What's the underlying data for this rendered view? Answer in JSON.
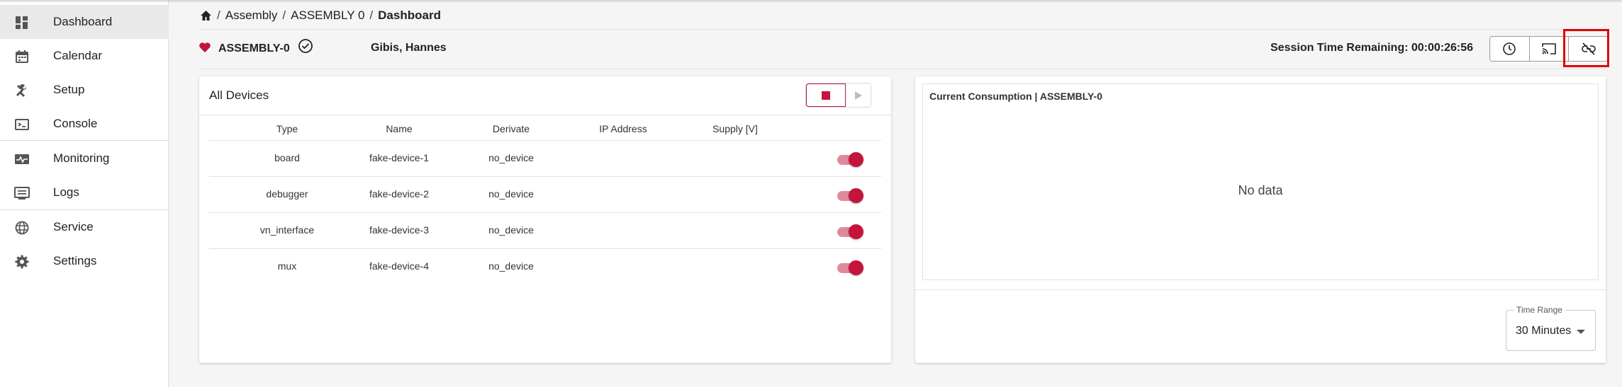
{
  "sidebar": {
    "items": [
      {
        "label": "Dashboard",
        "icon": "dashboard-icon",
        "active": true
      },
      {
        "label": "Calendar",
        "icon": "calendar-icon"
      },
      {
        "label": "Setup",
        "icon": "tools-icon"
      },
      {
        "label": "Console",
        "icon": "console-icon"
      },
      {
        "label": "Monitoring",
        "icon": "monitoring-icon"
      },
      {
        "label": "Logs",
        "icon": "logs-icon"
      },
      {
        "label": "Service",
        "icon": "globe-icon"
      },
      {
        "label": "Settings",
        "icon": "gear-icon"
      }
    ]
  },
  "breadcrumb": {
    "home_icon": "home-icon",
    "items": [
      "Assembly",
      "ASSEMBLY 0",
      "Dashboard"
    ],
    "separator": "/"
  },
  "header": {
    "assembly_name": "ASSEMBLY-0",
    "user": "Gibis, Hannes",
    "session_label": "Session Time Remaining: 00:00:26:56",
    "buttons": [
      "history-icon",
      "cast-icon",
      "link-off-icon"
    ]
  },
  "devices": {
    "title": "All Devices",
    "columns": [
      "Type",
      "Name",
      "Derivate",
      "IP Address",
      "Supply [V]"
    ],
    "rows": [
      {
        "type": "board",
        "name": "fake-device-1",
        "derivate": "no_device",
        "ip": "",
        "supply": "",
        "enabled": true
      },
      {
        "type": "debugger",
        "name": "fake-device-2",
        "derivate": "no_device",
        "ip": "",
        "supply": "",
        "enabled": true
      },
      {
        "type": "vn_interface",
        "name": "fake-device-3",
        "derivate": "no_device",
        "ip": "",
        "supply": "",
        "enabled": true
      },
      {
        "type": "mux",
        "name": "fake-device-4",
        "derivate": "no_device",
        "ip": "",
        "supply": "",
        "enabled": true
      }
    ]
  },
  "consumption": {
    "title": "Current Consumption | ASSEMBLY-0",
    "empty_text": "No data",
    "time_range": {
      "label": "Time Range",
      "value": "30 Minutes"
    }
  },
  "colors": {
    "accent": "#c4143c",
    "accent_light": "#e0899d",
    "highlight": "#e00000"
  }
}
